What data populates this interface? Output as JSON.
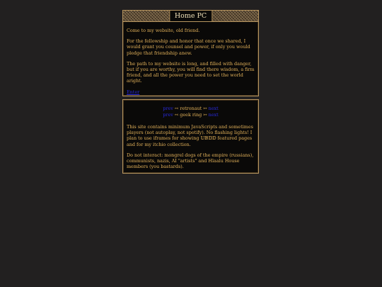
{
  "welcome": {
    "title": "Home PC",
    "paragraphs": [
      "Come to my website, old friend.",
      "For the fellowship and honor that once we shared, I would grant you counsel and power, if only you would pledge that friendship anew.",
      "The path to my website is long, and filled with danger, but if you are worthy, you will find there wisdom, a firm friend, and all the power you need to set the world aright."
    ],
    "enter_label": "Enter"
  },
  "info": {
    "rings": [
      {
        "prev_label": "prev",
        "left_symbol": "↢",
        "name": "retronaut",
        "right_symbol": "↣",
        "next_label": "next"
      },
      {
        "prev_label": "prev",
        "left_symbol": "↢",
        "name": "geek ring",
        "right_symbol": "↣",
        "next_label": "next"
      }
    ],
    "paragraphs": [
      "This site contains minimum JavaScripts and sometimes players (not autoplay, not spotify). No flashing lights! I plan to use iframes for showing 𝕌𝔹𝔻𝔻 featured pages and for my itchio collection.",
      "Do not interact: mongrel dogs of the empire (russians), communists, nazis, AI \"artists\" and Hlaalu House members (you bastards)."
    ]
  },
  "colors": {
    "background": "#222020",
    "panel": "#0a0908",
    "text": "#e3b25a",
    "link": "#2a2ae0",
    "border": "#b89660"
  }
}
